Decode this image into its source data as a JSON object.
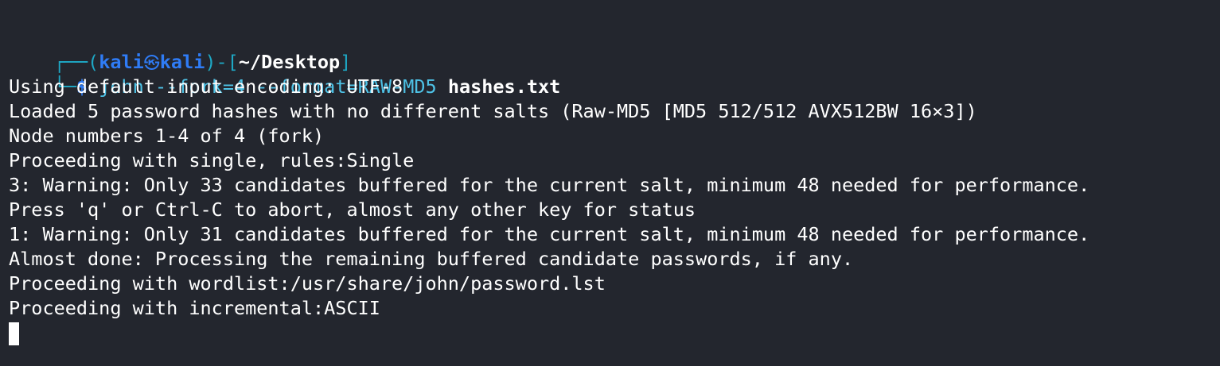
{
  "prompt": {
    "top_frame": "┌──(",
    "user": "kali",
    "separator_icon": "㉿",
    "host": "kali",
    "bracket_mid": ")-[",
    "cwd": "~/Desktop",
    "bracket_end": "]",
    "bottom_frame": "└─",
    "symbol": "$"
  },
  "command": {
    "args": "john --fork=4 --format=RAW-MD5",
    "file": "hashes.txt"
  },
  "output": [
    "Using default input encoding: UTF-8",
    "Loaded 5 password hashes with no different salts (Raw-MD5 [MD5 512/512 AVX512BW 16×3])",
    "Node numbers 1-4 of 4 (fork)",
    "Proceeding with single, rules:Single",
    "3: Warning: Only 33 candidates buffered for the current salt, minimum 48 needed for performance.",
    "Press 'q' or Ctrl-C to abort, almost any other key for status",
    "1: Warning: Only 31 candidates buffered for the current salt, minimum 48 needed for performance.",
    "Almost done: Processing the remaining buffered candidate passwords, if any.",
    "Proceeding with wordlist:/usr/share/john/password.lst",
    "Proceeding with incremental:ASCII"
  ],
  "colors": {
    "background": "#23262e",
    "prompt_user": "#2f7cf6",
    "prompt_frame": "#1ea7c4",
    "command": "#4ec2e6",
    "text": "#ffffff"
  }
}
